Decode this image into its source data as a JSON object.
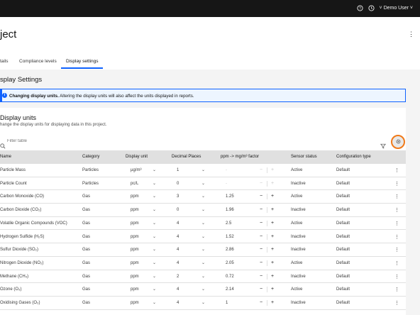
{
  "header": {
    "help_icon": "help-icon",
    "settings_icon": "clock-icon",
    "user_menu": "˅ Demo User ˅",
    "page_title": "ject"
  },
  "tabs": [
    {
      "label": "tails",
      "active": false
    },
    {
      "label": "Compliance levels",
      "active": false
    },
    {
      "label": "Display settings",
      "active": true
    }
  ],
  "section": {
    "title": "splay Settings",
    "notice_bold": "Changing display units.",
    "notice_text": " Altering the display units will also affect the units displayed in reports."
  },
  "panel": {
    "title": "Display units",
    "subtitle": "hange the display units for displaying data in this project.",
    "filter_placeholder": "Filter table"
  },
  "columns": [
    "Name",
    "Category",
    "Display unit",
    "Decimal Places",
    "ppm -> mg/m³ factor",
    "Sensor status",
    "Configuration type"
  ],
  "rows": [
    {
      "name": "Particle Mass",
      "category": "Particles",
      "unit": "µg/m³",
      "decimals": "1",
      "factor": "-",
      "factor_disabled": true,
      "status": "Active",
      "config": "Default"
    },
    {
      "name": "Particle Count",
      "category": "Particles",
      "unit": "pc/L",
      "decimals": "0",
      "factor": "-",
      "factor_disabled": true,
      "status": "Inactive",
      "config": "Default"
    },
    {
      "name": "Carbon Monoxide (CO)",
      "category": "Gas",
      "unit": "ppm",
      "decimals": "3",
      "factor": "1.25",
      "factor_disabled": false,
      "status": "Active",
      "config": "Default"
    },
    {
      "name": "Carbon Dioxide (CO₂)",
      "category": "Gas",
      "unit": "ppm",
      "decimals": "0",
      "factor": "1.96",
      "factor_disabled": false,
      "status": "Inactive",
      "config": "Default"
    },
    {
      "name": "Volatile Organic Compounds (VOC)",
      "category": "Gas",
      "unit": "ppm",
      "decimals": "4",
      "factor": "2.5",
      "factor_disabled": false,
      "status": "Active",
      "config": "Default"
    },
    {
      "name": "Hydrogen Sulfide (H₂S)",
      "category": "Gas",
      "unit": "ppm",
      "decimals": "4",
      "factor": "1.52",
      "factor_disabled": false,
      "status": "Inactive",
      "config": "Default"
    },
    {
      "name": "Sulfur Dioxide (SO₂)",
      "category": "Gas",
      "unit": "ppm",
      "decimals": "4",
      "factor": "2.86",
      "factor_disabled": false,
      "status": "Inactive",
      "config": "Default"
    },
    {
      "name": "Nitrogen Dioxide (NO₂)",
      "category": "Gas",
      "unit": "ppm",
      "decimals": "4",
      "factor": "2.05",
      "factor_disabled": false,
      "status": "Active",
      "config": "Default"
    },
    {
      "name": "Methane (CH₄)",
      "category": "Gas",
      "unit": "ppm",
      "decimals": "2",
      "factor": "0.72",
      "factor_disabled": false,
      "status": "Inactive",
      "config": "Default"
    },
    {
      "name": "Ozone (O₃)",
      "category": "Gas",
      "unit": "ppm",
      "decimals": "4",
      "factor": "2.14",
      "factor_disabled": false,
      "status": "Active",
      "config": "Default"
    },
    {
      "name": "Oxidising Gases (O₃)",
      "category": "Gas",
      "unit": "ppm",
      "decimals": "4",
      "factor": "1",
      "factor_disabled": false,
      "status": "Inactive",
      "config": "Default"
    }
  ],
  "colors": {
    "accent": "#0f62fe",
    "highlight_ring": "#f07a1a",
    "topbar": "#161616"
  }
}
